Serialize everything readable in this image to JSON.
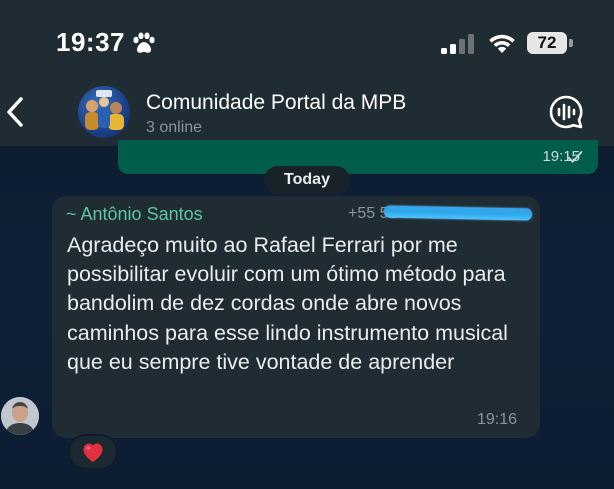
{
  "status_bar": {
    "time": "19:37",
    "battery": "72",
    "icons": [
      "paw-icon",
      "cellular-signal-icon",
      "wifi-icon",
      "battery-icon"
    ]
  },
  "header": {
    "back_icon": "chevron-left-icon",
    "group_name": "Comunidade Portal da MPB",
    "subtitle": "3 online",
    "action_icon": "voice-chat-icon"
  },
  "chat": {
    "outgoing": {
      "time": "19:15",
      "status_icon": "single-check-icon"
    },
    "date_separator": "Today",
    "incoming": {
      "sender": "~ Antônio Santos",
      "phone_visible": "+55 51",
      "text": "Agradeço muito ao Rafael Ferrari por me possibilitar evoluir com um ótimo método para bandolim de dez cordas onde abre novos caminhos para esse lindo instrumento musical que eu sempre tive vontade de aprender",
      "time": "19:16",
      "reaction": "❤️"
    }
  },
  "colors": {
    "header_bg": "#1f2c33",
    "incoming_bubble": "#202c33",
    "outgoing_bubble": "#005c4b",
    "sender_name": "#5fc4a6",
    "secondary_text": "#8696a0"
  }
}
